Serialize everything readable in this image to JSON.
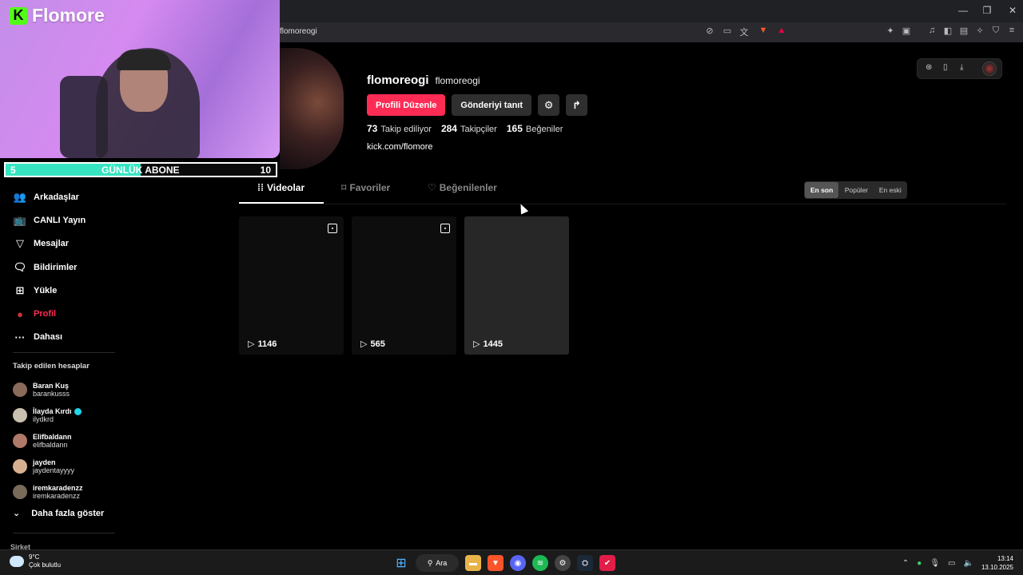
{
  "window": {
    "minimize": "—",
    "restore": "❐",
    "close": "✕"
  },
  "address": {
    "url": "flomoreogi"
  },
  "stream": {
    "brand": "Flomore",
    "sub_goal": {
      "current": "5",
      "label": "GÜNLÜK ABONE",
      "target": "10",
      "progress": 0.5
    }
  },
  "sidebar": {
    "items": [
      {
        "icon": "friends-icon",
        "glyph": "👥",
        "label": "Arkadaşlar"
      },
      {
        "icon": "live-icon",
        "glyph": "📺",
        "label": "CANLI Yayın"
      },
      {
        "icon": "messages-icon",
        "glyph": "▽",
        "label": "Mesajlar"
      },
      {
        "icon": "notifications-icon",
        "glyph": "🗨",
        "label": "Bildirimler"
      },
      {
        "icon": "upload-icon",
        "glyph": "⊞",
        "label": "Yükle"
      },
      {
        "icon": "profile-icon",
        "glyph": "●",
        "label": "Profil"
      },
      {
        "icon": "more-icon",
        "glyph": "···",
        "label": "Dahası"
      }
    ],
    "following_title": "Takip edilen hesaplar",
    "following": [
      {
        "name": "Baran Kuş",
        "handle": "barankusss",
        "verified": false,
        "color": "#8a6a5a"
      },
      {
        "name": "İlayda Kırdı",
        "handle": "ilydkrd",
        "verified": true,
        "color": "#c9c0b0"
      },
      {
        "name": "Elifbaldann",
        "handle": "elifbaldann",
        "verified": false,
        "color": "#b07a68"
      },
      {
        "name": "jayden",
        "handle": "jaydentayyyy",
        "verified": false,
        "color": "#d8b090"
      },
      {
        "name": "iremkaradenzz",
        "handle": "iremkaradenzz",
        "verified": false,
        "color": "#7a6a5a"
      }
    ],
    "show_more": "Daha fazla göster",
    "company": "Şirket"
  },
  "profile": {
    "username": "flomoreogi",
    "nickname": "flomoreogi",
    "edit_button": "Profili Düzenle",
    "promote_button": "Gönderiyi tanıt",
    "stats": [
      {
        "value": "73",
        "label": "Takip ediliyor"
      },
      {
        "value": "284",
        "label": "Takipçiler"
      },
      {
        "value": "165",
        "label": "Beğeniler"
      }
    ],
    "link": "kick.com/flomore"
  },
  "tabs": [
    {
      "label": "Videolar",
      "glyph": "⁞⁞"
    },
    {
      "label": "Favoriler",
      "glyph": "⌑"
    },
    {
      "label": "Beğenilenler",
      "glyph": "♡"
    }
  ],
  "sort": [
    "En son",
    "Popüler",
    "En eski"
  ],
  "videos": [
    {
      "views": "1146"
    },
    {
      "views": "565"
    },
    {
      "views": "1445"
    }
  ],
  "taskbar": {
    "weather_temp": "9°C",
    "weather_desc": "Çok bulutlu",
    "search_label": "Ara",
    "time": "13:14",
    "date": "13.10.2025"
  }
}
